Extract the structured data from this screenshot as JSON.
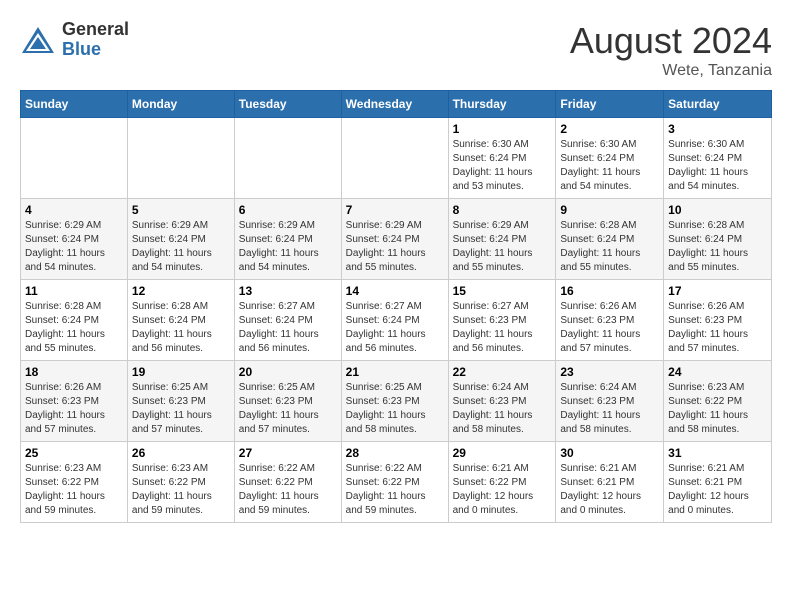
{
  "logo": {
    "general": "General",
    "blue": "Blue"
  },
  "title": {
    "month_year": "August 2024",
    "location": "Wete, Tanzania"
  },
  "days_of_week": [
    "Sunday",
    "Monday",
    "Tuesday",
    "Wednesday",
    "Thursday",
    "Friday",
    "Saturday"
  ],
  "weeks": [
    [
      {
        "day": "",
        "info": ""
      },
      {
        "day": "",
        "info": ""
      },
      {
        "day": "",
        "info": ""
      },
      {
        "day": "",
        "info": ""
      },
      {
        "day": "1",
        "info": "Sunrise: 6:30 AM\nSunset: 6:24 PM\nDaylight: 11 hours\nand 53 minutes."
      },
      {
        "day": "2",
        "info": "Sunrise: 6:30 AM\nSunset: 6:24 PM\nDaylight: 11 hours\nand 54 minutes."
      },
      {
        "day": "3",
        "info": "Sunrise: 6:30 AM\nSunset: 6:24 PM\nDaylight: 11 hours\nand 54 minutes."
      }
    ],
    [
      {
        "day": "4",
        "info": "Sunrise: 6:29 AM\nSunset: 6:24 PM\nDaylight: 11 hours\nand 54 minutes."
      },
      {
        "day": "5",
        "info": "Sunrise: 6:29 AM\nSunset: 6:24 PM\nDaylight: 11 hours\nand 54 minutes."
      },
      {
        "day": "6",
        "info": "Sunrise: 6:29 AM\nSunset: 6:24 PM\nDaylight: 11 hours\nand 54 minutes."
      },
      {
        "day": "7",
        "info": "Sunrise: 6:29 AM\nSunset: 6:24 PM\nDaylight: 11 hours\nand 55 minutes."
      },
      {
        "day": "8",
        "info": "Sunrise: 6:29 AM\nSunset: 6:24 PM\nDaylight: 11 hours\nand 55 minutes."
      },
      {
        "day": "9",
        "info": "Sunrise: 6:28 AM\nSunset: 6:24 PM\nDaylight: 11 hours\nand 55 minutes."
      },
      {
        "day": "10",
        "info": "Sunrise: 6:28 AM\nSunset: 6:24 PM\nDaylight: 11 hours\nand 55 minutes."
      }
    ],
    [
      {
        "day": "11",
        "info": "Sunrise: 6:28 AM\nSunset: 6:24 PM\nDaylight: 11 hours\nand 55 minutes."
      },
      {
        "day": "12",
        "info": "Sunrise: 6:28 AM\nSunset: 6:24 PM\nDaylight: 11 hours\nand 56 minutes."
      },
      {
        "day": "13",
        "info": "Sunrise: 6:27 AM\nSunset: 6:24 PM\nDaylight: 11 hours\nand 56 minutes."
      },
      {
        "day": "14",
        "info": "Sunrise: 6:27 AM\nSunset: 6:24 PM\nDaylight: 11 hours\nand 56 minutes."
      },
      {
        "day": "15",
        "info": "Sunrise: 6:27 AM\nSunset: 6:23 PM\nDaylight: 11 hours\nand 56 minutes."
      },
      {
        "day": "16",
        "info": "Sunrise: 6:26 AM\nSunset: 6:23 PM\nDaylight: 11 hours\nand 57 minutes."
      },
      {
        "day": "17",
        "info": "Sunrise: 6:26 AM\nSunset: 6:23 PM\nDaylight: 11 hours\nand 57 minutes."
      }
    ],
    [
      {
        "day": "18",
        "info": "Sunrise: 6:26 AM\nSunset: 6:23 PM\nDaylight: 11 hours\nand 57 minutes."
      },
      {
        "day": "19",
        "info": "Sunrise: 6:25 AM\nSunset: 6:23 PM\nDaylight: 11 hours\nand 57 minutes."
      },
      {
        "day": "20",
        "info": "Sunrise: 6:25 AM\nSunset: 6:23 PM\nDaylight: 11 hours\nand 57 minutes."
      },
      {
        "day": "21",
        "info": "Sunrise: 6:25 AM\nSunset: 6:23 PM\nDaylight: 11 hours\nand 58 minutes."
      },
      {
        "day": "22",
        "info": "Sunrise: 6:24 AM\nSunset: 6:23 PM\nDaylight: 11 hours\nand 58 minutes."
      },
      {
        "day": "23",
        "info": "Sunrise: 6:24 AM\nSunset: 6:23 PM\nDaylight: 11 hours\nand 58 minutes."
      },
      {
        "day": "24",
        "info": "Sunrise: 6:23 AM\nSunset: 6:22 PM\nDaylight: 11 hours\nand 58 minutes."
      }
    ],
    [
      {
        "day": "25",
        "info": "Sunrise: 6:23 AM\nSunset: 6:22 PM\nDaylight: 11 hours\nand 59 minutes."
      },
      {
        "day": "26",
        "info": "Sunrise: 6:23 AM\nSunset: 6:22 PM\nDaylight: 11 hours\nand 59 minutes."
      },
      {
        "day": "27",
        "info": "Sunrise: 6:22 AM\nSunset: 6:22 PM\nDaylight: 11 hours\nand 59 minutes."
      },
      {
        "day": "28",
        "info": "Sunrise: 6:22 AM\nSunset: 6:22 PM\nDaylight: 11 hours\nand 59 minutes."
      },
      {
        "day": "29",
        "info": "Sunrise: 6:21 AM\nSunset: 6:22 PM\nDaylight: 12 hours\nand 0 minutes."
      },
      {
        "day": "30",
        "info": "Sunrise: 6:21 AM\nSunset: 6:21 PM\nDaylight: 12 hours\nand 0 minutes."
      },
      {
        "day": "31",
        "info": "Sunrise: 6:21 AM\nSunset: 6:21 PM\nDaylight: 12 hours\nand 0 minutes."
      }
    ]
  ]
}
